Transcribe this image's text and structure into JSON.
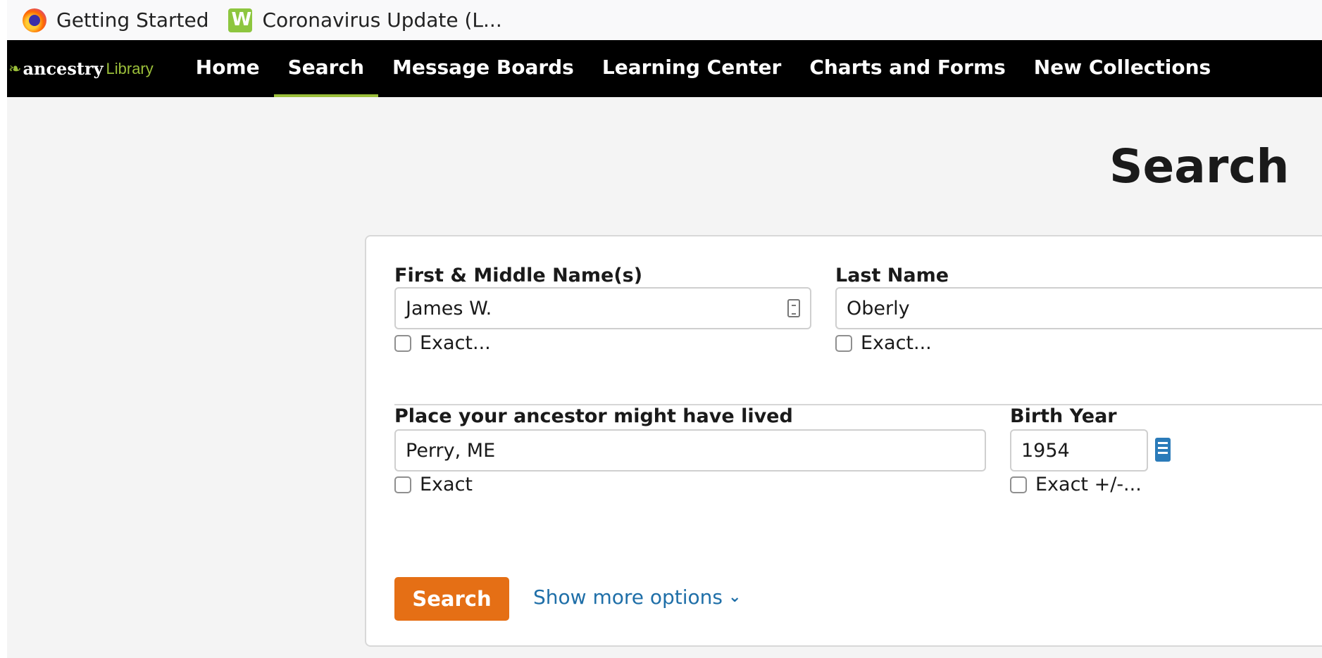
{
  "bookmarks": [
    {
      "label": "Getting Started",
      "icon": "firefox-icon"
    },
    {
      "label": "Coronavirus Update (L...",
      "icon": "w-logo-icon"
    }
  ],
  "nav": {
    "logo": {
      "brand": "ancestry",
      "sub": "Library",
      "icon": "ancestry-leaf-icon"
    },
    "items": [
      "Home",
      "Search",
      "Message Boards",
      "Learning Center",
      "Charts and Forms",
      "New Collections"
    ],
    "active": "Search"
  },
  "page": {
    "title": "Search"
  },
  "form": {
    "first_name": {
      "label": "First & Middle Name(s)",
      "value": "James W.",
      "exact_label": "Exact..."
    },
    "last_name": {
      "label": "Last Name",
      "value": "Oberly",
      "exact_label": "Exact..."
    },
    "place": {
      "label": "Place your ancestor might have lived",
      "value": "Perry, ME",
      "exact_label": "Exact"
    },
    "birth_year": {
      "label": "Birth Year",
      "value": "1954",
      "exact_label": "Exact +/-..."
    },
    "search_button": "Search",
    "more_options": "Show more options"
  },
  "colors": {
    "accent": "#e56f15",
    "link": "#1f6fa8",
    "brand_green": "#9bbf3a",
    "nav_bg": "#000000"
  }
}
